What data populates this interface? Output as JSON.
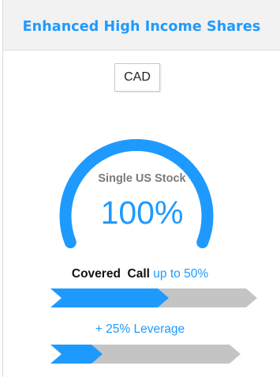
{
  "header": {
    "title": "Enhanced High Income Shares"
  },
  "currency": {
    "selected": "CAD"
  },
  "gauge": {
    "label": "Single US Stock",
    "value_text": "100%",
    "fill_fraction": 1.0,
    "color": "#1e9aff"
  },
  "covered_call": {
    "label_bold": "Covered",
    "label_bold2": "Call",
    "label_blue": "up to 50%",
    "fill_fraction": 0.5
  },
  "leverage": {
    "label": "+ 25% Leverage",
    "fill_fraction": 0.25
  },
  "colors": {
    "accent": "#1e9aff",
    "track": "#c4c4c4",
    "header_bg": "#f2f2f2"
  }
}
